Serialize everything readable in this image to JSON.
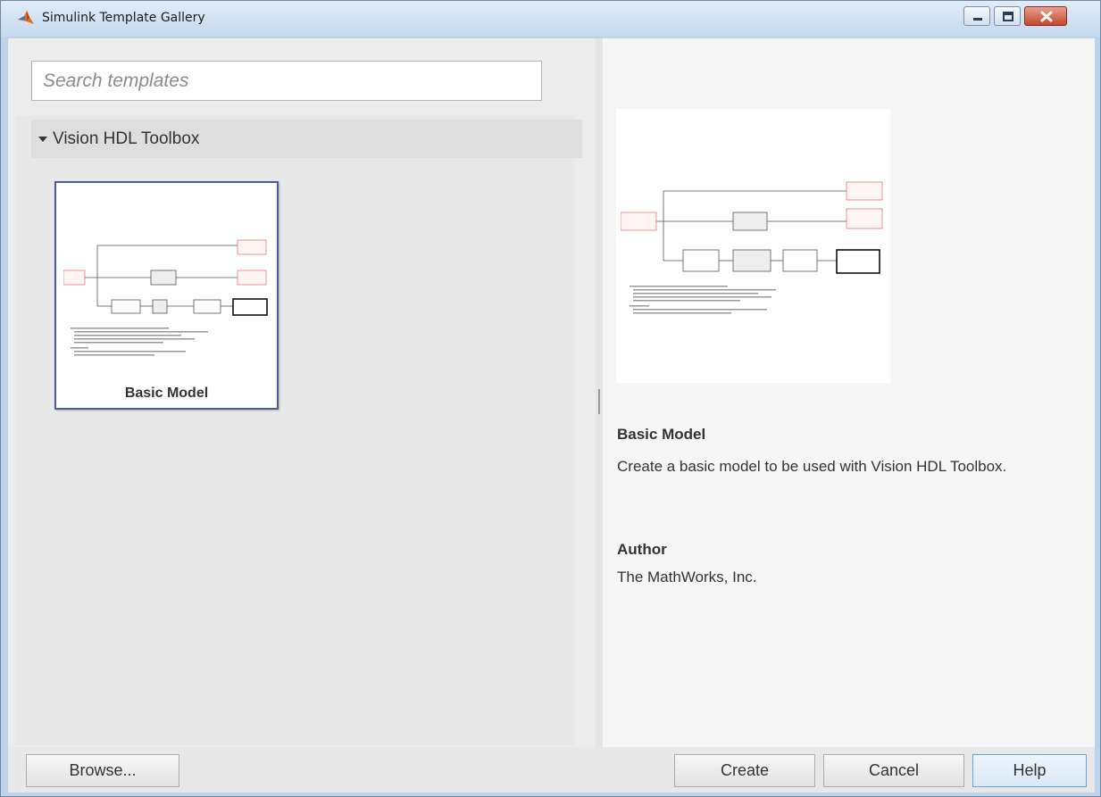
{
  "window": {
    "title": "Simulink Template Gallery",
    "app_icon": "matlab-membrane-icon",
    "controls": [
      "minimize-icon",
      "maximize-icon",
      "close-icon"
    ]
  },
  "search": {
    "placeholder": "Search templates",
    "value": ""
  },
  "gallery": {
    "group_label": "Vision HDL Toolbox",
    "expanded": true,
    "templates": [
      {
        "label": "Basic Model",
        "selected": true
      }
    ]
  },
  "details": {
    "title": "Basic Model",
    "description": "Create a basic model to be used with Vision HDL Toolbox.",
    "author_heading": "Author",
    "author": "The MathWorks, Inc."
  },
  "buttons": {
    "browse": "Browse...",
    "create": "Create",
    "cancel": "Cancel",
    "help": "Help"
  },
  "colors": {
    "selection_border": "#4f5aa0",
    "pane_background": "#ececec",
    "help_border": "#6ba3d9"
  }
}
